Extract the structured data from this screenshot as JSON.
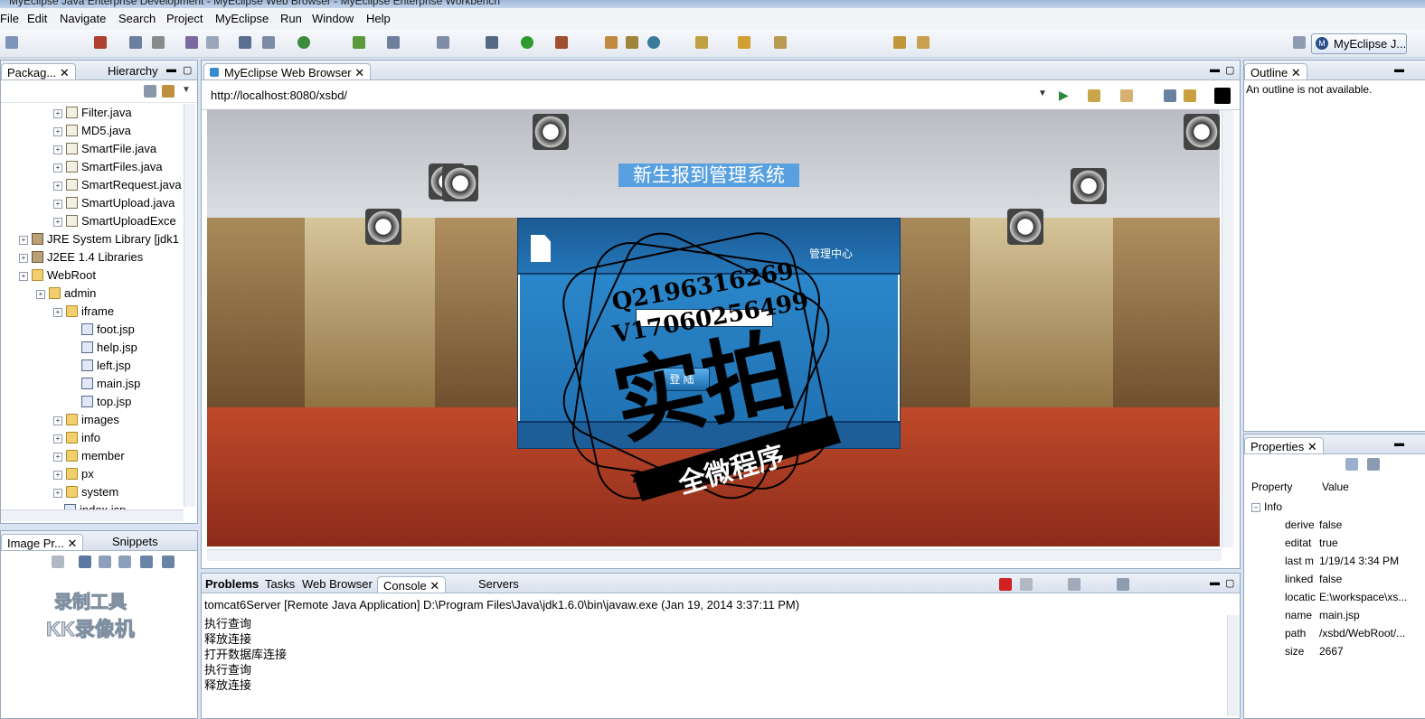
{
  "window": {
    "title": "MyEclipse Java Enterprise Development - MyEclipse Web Browser - MyEclipse Enterprise Workbench"
  },
  "menu": [
    "File",
    "Edit",
    "Navigate",
    "Search",
    "Project",
    "MyEclipse",
    "Run",
    "Window",
    "Help"
  ],
  "perspective": {
    "label": "MyEclipse J..."
  },
  "package_explorer": {
    "tabs": [
      "Packag...",
      "Hierarchy"
    ],
    "items": [
      {
        "label": "Filter.java",
        "icon": "java-file-icon",
        "level": 3
      },
      {
        "label": "MD5.java",
        "icon": "java-file-icon",
        "level": 3
      },
      {
        "label": "SmartFile.java",
        "icon": "java-file-icon",
        "level": 3
      },
      {
        "label": "SmartFiles.java",
        "icon": "java-file-icon",
        "level": 3
      },
      {
        "label": "SmartRequest.java",
        "icon": "java-file-icon",
        "level": 3
      },
      {
        "label": "SmartUpload.java",
        "icon": "java-file-icon",
        "level": 3
      },
      {
        "label": "SmartUploadExce",
        "icon": "java-file-icon",
        "level": 3
      },
      {
        "label": "JRE System Library [jdk1",
        "icon": "library-icon",
        "level": 1
      },
      {
        "label": "J2EE 1.4 Libraries",
        "icon": "library-icon",
        "level": 1
      },
      {
        "label": "WebRoot",
        "icon": "folder-icon",
        "level": 1
      },
      {
        "label": "admin",
        "icon": "folder-icon",
        "level": 2
      },
      {
        "label": "iframe",
        "icon": "folder-icon",
        "level": 3
      },
      {
        "label": "foot.jsp",
        "icon": "jsp-file-icon",
        "level": 4
      },
      {
        "label": "help.jsp",
        "icon": "jsp-file-icon",
        "level": 4
      },
      {
        "label": "left.jsp",
        "icon": "jsp-file-icon",
        "level": 4
      },
      {
        "label": "main.jsp",
        "icon": "jsp-file-icon",
        "level": 4
      },
      {
        "label": "top.jsp",
        "icon": "jsp-file-icon",
        "level": 4
      },
      {
        "label": "images",
        "icon": "folder-icon",
        "level": 3
      },
      {
        "label": "info",
        "icon": "folder-icon",
        "level": 3
      },
      {
        "label": "member",
        "icon": "folder-icon",
        "level": 3
      },
      {
        "label": "px",
        "icon": "folder-icon",
        "level": 3
      },
      {
        "label": "system",
        "icon": "folder-icon",
        "level": 3
      },
      {
        "label": "index.jsp",
        "icon": "jsp-file-icon",
        "level": 3
      }
    ]
  },
  "image_preview": {
    "tabs": [
      "Image Pr...",
      "Snippets"
    ]
  },
  "recorder_watermark": {
    "line1": "录制工具",
    "line2": "KK录像机"
  },
  "browser": {
    "tab": "MyEclipse Web Browser",
    "url": "http://localhost:8080/xsbd/",
    "page": {
      "title": "新生报到管理系统",
      "login_header": "管理中心",
      "login_button": "登 陆"
    }
  },
  "stamp": {
    "line1": "Q2196316269",
    "line2": "V17060256499",
    "big": "实拍",
    "banner": "全微程序"
  },
  "outline": {
    "tab": "Outline",
    "message": "An outline is not available."
  },
  "properties": {
    "tab": "Properties",
    "col_property": "Property",
    "col_value": "Value",
    "group": "Info",
    "rows": [
      {
        "name": "derive",
        "value": "false"
      },
      {
        "name": "editat",
        "value": "true"
      },
      {
        "name": "last m",
        "value": "1/19/14 3:34 PM"
      },
      {
        "name": "linked",
        "value": "false"
      },
      {
        "name": "locatic",
        "value": "E:\\workspace\\xs..."
      },
      {
        "name": "name",
        "value": "main.jsp"
      },
      {
        "name": "path",
        "value": "/xsbd/WebRoot/..."
      },
      {
        "name": "size",
        "value": "2667"
      }
    ]
  },
  "console": {
    "tabs": [
      "Problems",
      "Tasks",
      "Web Browser",
      "Console",
      "Servers"
    ],
    "header": "tomcat6Server [Remote Java Application] D:\\Program Files\\Java\\jdk1.6.0\\bin\\javaw.exe (Jan 19, 2014 3:37:11 PM)",
    "lines": [
      "执行查询",
      "释放连接",
      "打开数据库连接",
      "执行查询",
      "释放连接"
    ]
  },
  "colors": {
    "accent": "#1e6eae",
    "stamp": "#000000",
    "title_bg": "#58a0e0"
  }
}
